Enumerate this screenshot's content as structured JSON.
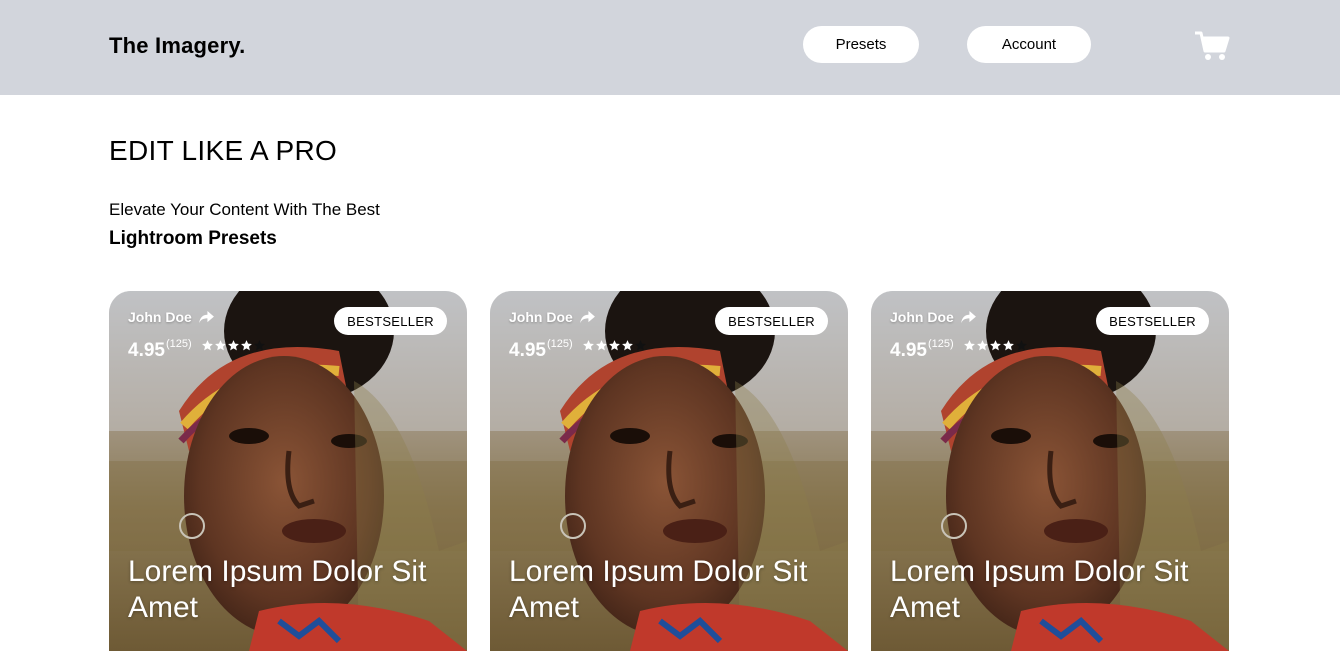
{
  "header": {
    "logo": "The Imagery.",
    "nav": {
      "presets": "Presets",
      "account": "Account"
    },
    "cart_icon": "shopping-cart-icon"
  },
  "hero": {
    "title": "EDIT LIKE A PRO",
    "subtitle": "Elevate Your Content With The Best",
    "subtitle_emphasis": "Lightroom Presets"
  },
  "cards": [
    {
      "author": "John Doe",
      "rating": "4.95",
      "reviews": "(125)",
      "stars": 4,
      "badge": "BESTSELLER",
      "title": "Lorem Ipsum Dolor Sit Amet"
    },
    {
      "author": "John Doe",
      "rating": "4.95",
      "reviews": "(125)",
      "stars": 4,
      "badge": "BESTSELLER",
      "title": "Lorem Ipsum Dolor Sit Amet"
    },
    {
      "author": "John Doe",
      "rating": "4.95",
      "reviews": "(125)",
      "stars": 4,
      "badge": "BESTSELLER",
      "title": "Lorem Ipsum Dolor Sit Amet"
    }
  ],
  "colors": {
    "header_bg": "#d2d5dc",
    "page_bg": "#ffffff"
  }
}
